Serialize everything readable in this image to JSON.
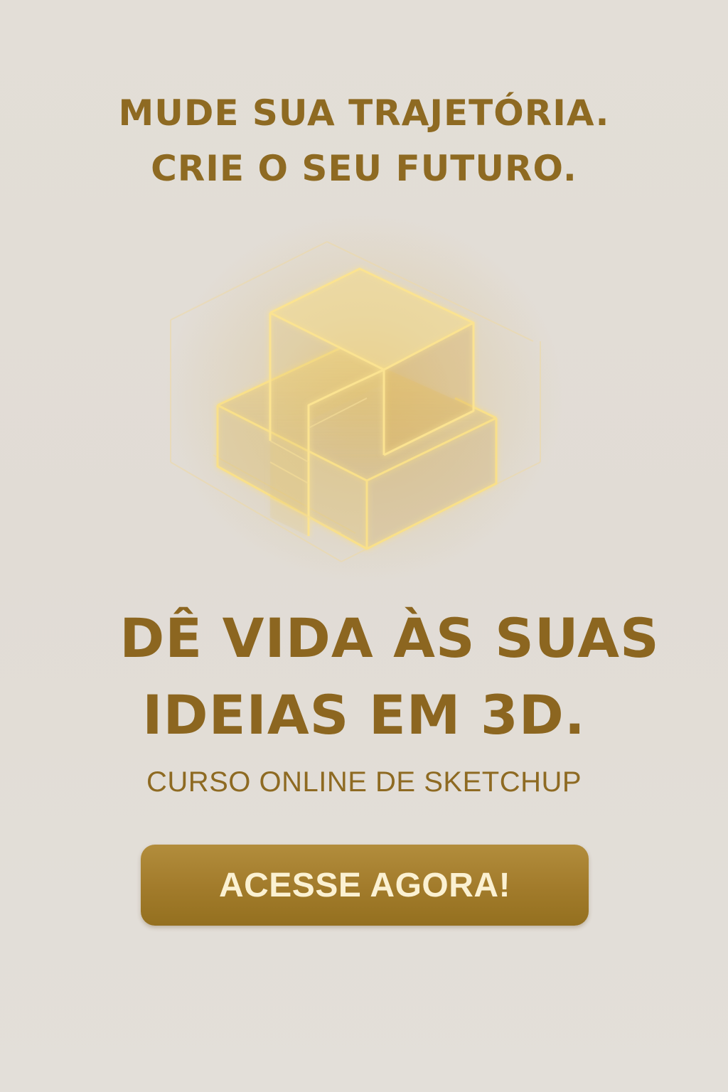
{
  "headline": {
    "line1": "MUDE SUA TRAJETÓRIA.",
    "line2": "CRIE O SEU FUTURO."
  },
  "illustration": {
    "icon": "glowing-3d-blocks-icon"
  },
  "title": {
    "line1": "DÊ VIDA ÀS SUAS",
    "line2": "IDEIAS EM 3D."
  },
  "subtitle": "CURSO ONLINE DE SKETCHUP",
  "cta": {
    "label": "ACESSE AGORA!"
  },
  "colors": {
    "background": "#e3ded7",
    "gold_text": "#8e6a22",
    "button": "#a37c2c",
    "button_text": "#fbf1d2",
    "glow": "#f6dc7e"
  }
}
